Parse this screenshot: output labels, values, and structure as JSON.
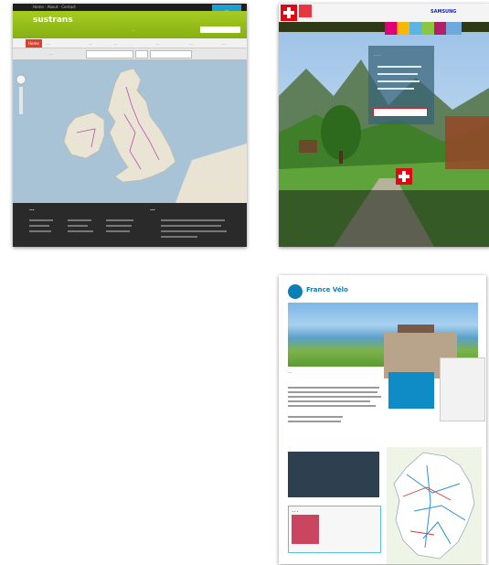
{
  "screenshots": [
    {
      "site": "UK cycle map website",
      "top_links": "Home · About · Contact",
      "top_button": "...",
      "logo": "sustrans",
      "header_links": "...",
      "nav_tabs": [
        "Home",
        "...",
        "...",
        "...",
        "...",
        "...",
        "..."
      ],
      "filter_label": "...",
      "footer_headings": [
        "...",
        "..."
      ],
      "accent_color": "#8fb81a"
    },
    {
      "site": "Swiss tourism website",
      "panel_title": "...",
      "sponsor": "SAMSUNG",
      "accent_color": "#e30613"
    },
    {
      "site": "France velo website",
      "logo_text": "France Vélo",
      "welcome_title": "...",
      "news_title": "...",
      "accent_color": "#0a7fb5"
    }
  ]
}
